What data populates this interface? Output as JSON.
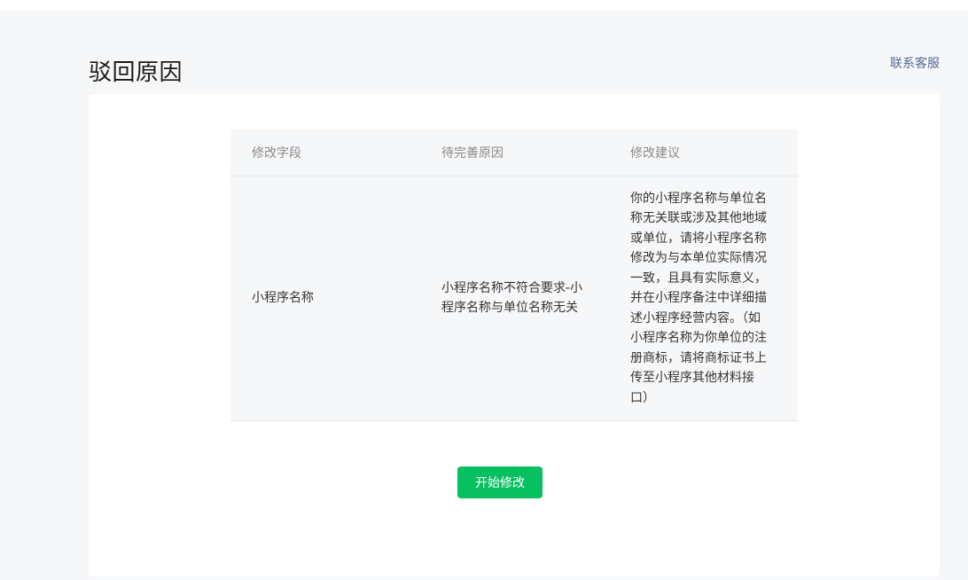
{
  "header": {
    "title": "驳回原因",
    "contact_label": "联系客服"
  },
  "table": {
    "columns": [
      "修改字段",
      "待完善原因",
      "修改建议"
    ],
    "rows": [
      {
        "field": "小程序名称",
        "reason": "小程序名称不符合要求-小程序名称与单位名称无关",
        "suggestion": "你的小程序名称与单位名称无关联或涉及其他地域或单位，请将小程序名称修改为与本单位实际情况一致，且具有实际意义，并在小程序备注中详细描述小程序经营内容。（如小程序名称为你单位的注册商标，请将商标证书上传至小程序其他材料接口）"
      }
    ]
  },
  "actions": {
    "start_label": "开始修改"
  },
  "colors": {
    "primary": "#07c160",
    "link": "#576b95",
    "background": "#f6f7f9"
  }
}
